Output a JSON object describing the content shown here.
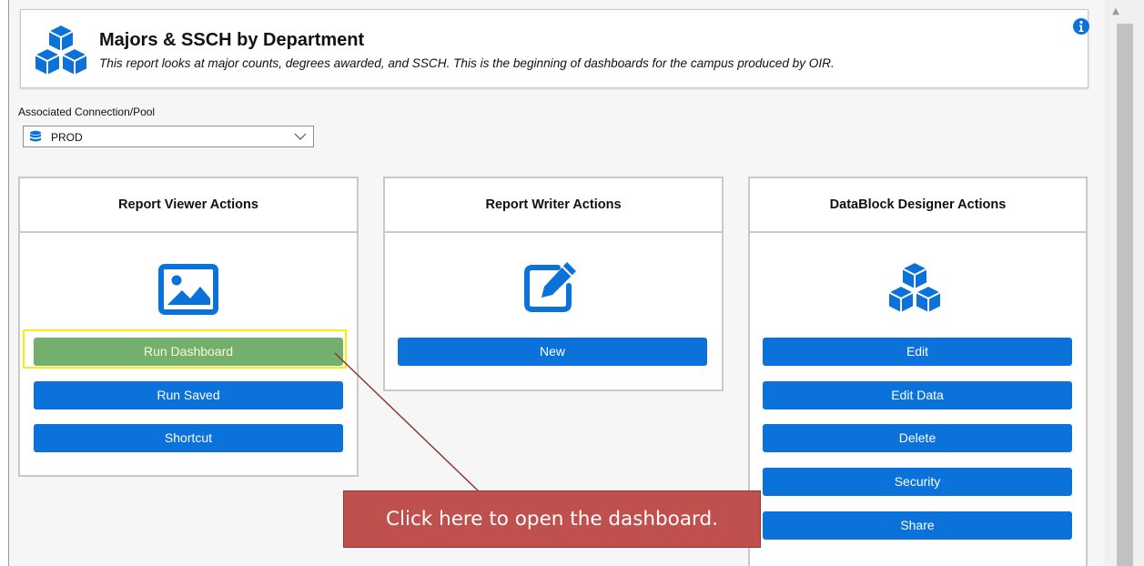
{
  "header": {
    "title": "Majors & SSCH by Department",
    "description": "This report looks at major counts, degrees awarded, and SSCH.  This is the beginning of dashboards for the campus produced by OIR.",
    "icon": "cubes-icon",
    "info_icon": "info-icon"
  },
  "connection": {
    "label": "Associated Connection/Pool",
    "selected": "PROD",
    "icon": "database-icon"
  },
  "panels": {
    "viewer": {
      "title": "Report Viewer Actions",
      "icon": "image-icon",
      "buttons": [
        "Run Dashboard",
        "Run Saved",
        "Shortcut"
      ]
    },
    "writer": {
      "title": "Report Writer Actions",
      "icon": "edit-icon",
      "buttons": [
        "New"
      ]
    },
    "designer": {
      "title": "DataBlock Designer Actions",
      "icon": "cubes-icon",
      "buttons": [
        "Edit",
        "Edit Data",
        "Delete",
        "Security",
        "Share"
      ]
    }
  },
  "callout": {
    "text": "Click here to open the dashboard."
  },
  "colors": {
    "button_blue": "#0b72d9",
    "button_green": "#74b06d",
    "highlight": "#f4f20a",
    "callout": "#c0504d"
  }
}
